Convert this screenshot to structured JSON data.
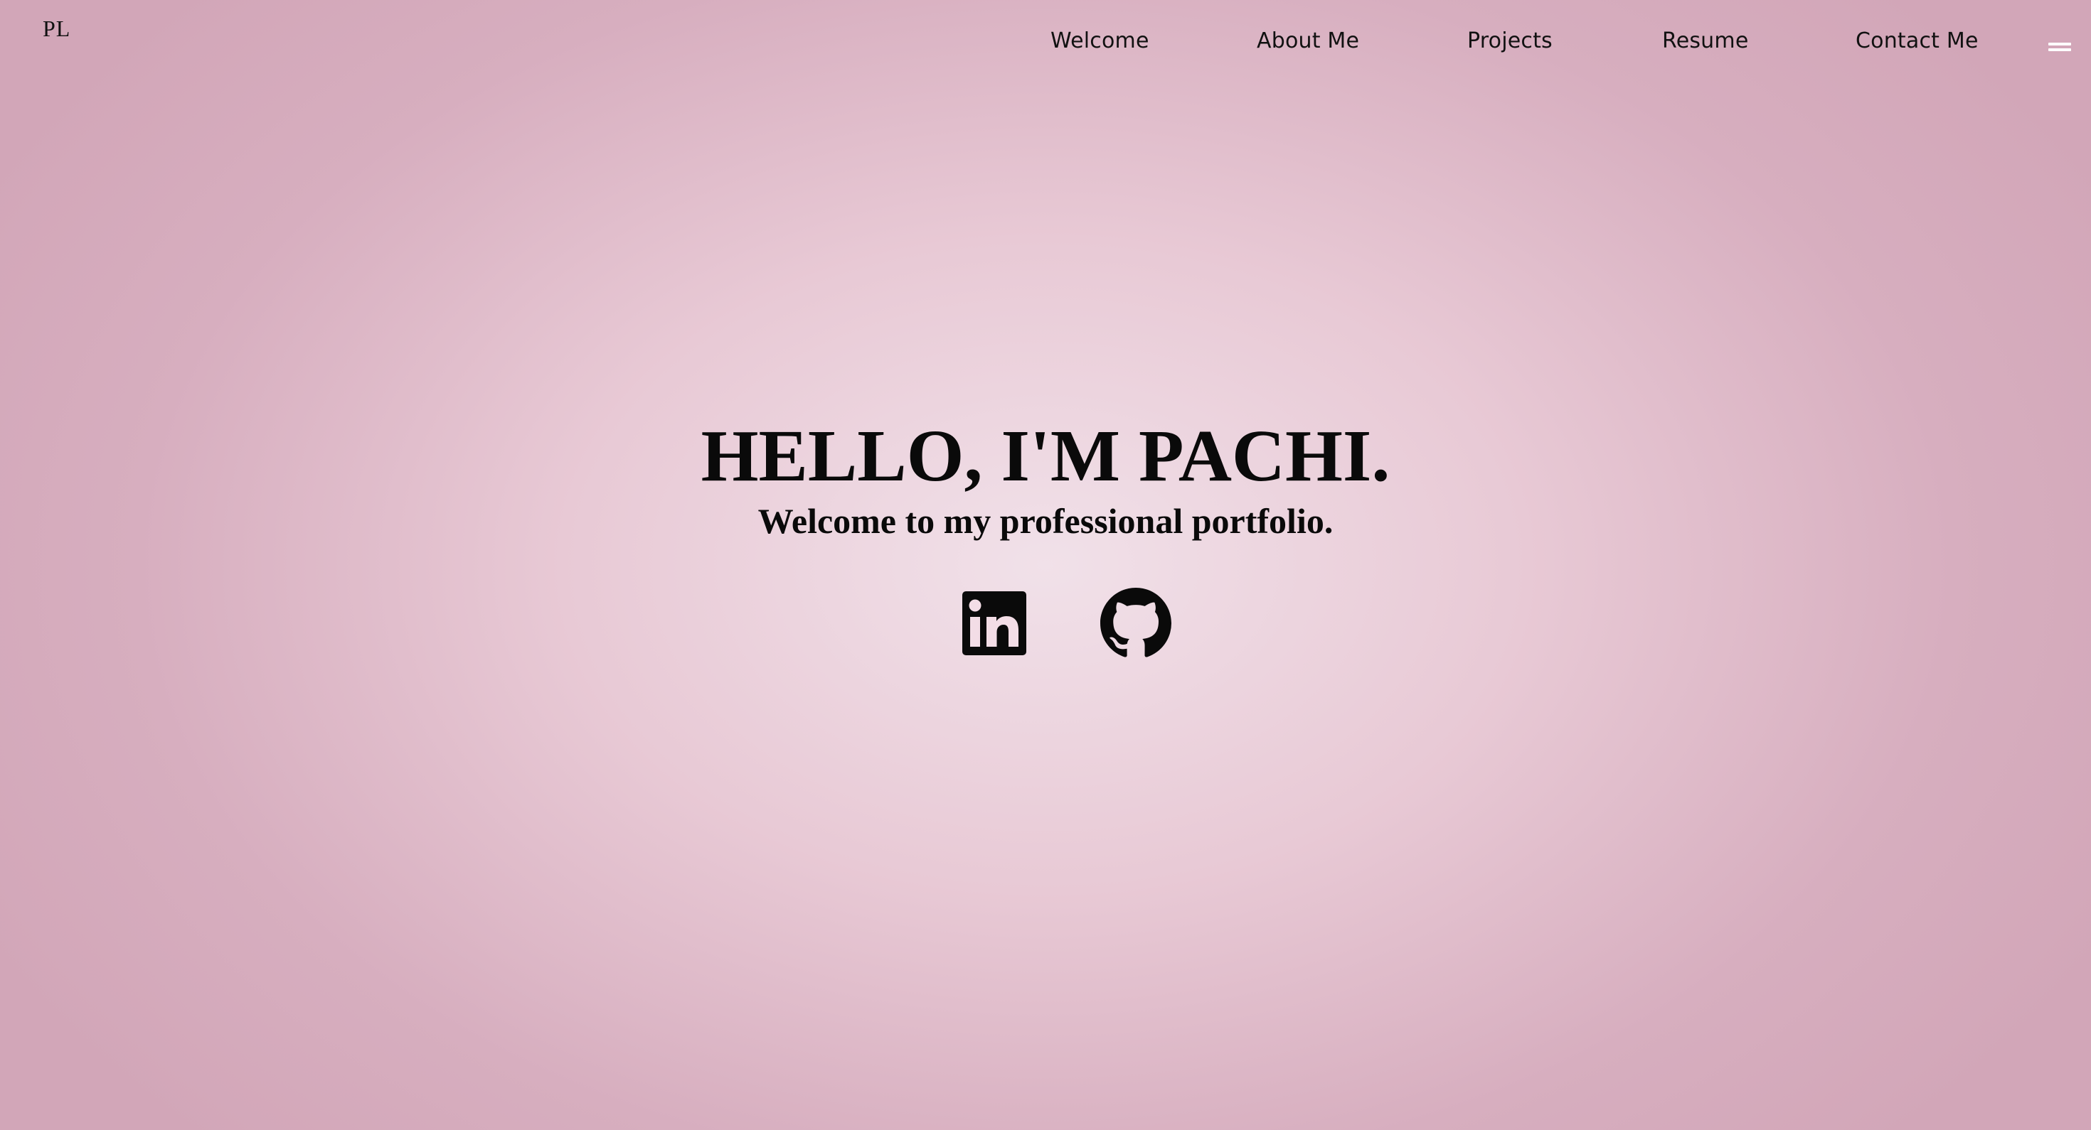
{
  "logo": {
    "text": "PL"
  },
  "nav": {
    "items": [
      {
        "label": "Welcome"
      },
      {
        "label": "About Me"
      },
      {
        "label": "Projects"
      },
      {
        "label": "Resume"
      },
      {
        "label": "Contact Me"
      }
    ]
  },
  "hero": {
    "title": "HELLO, I'M PACHI.",
    "subtitle": "Welcome to my professional portfolio."
  },
  "social": {
    "linkedin_icon": "linkedin-icon",
    "github_icon": "github-icon"
  },
  "colors": {
    "background_center": "#f1e1e9",
    "background_edge": "#d2a6b8",
    "text": "#0a0a0a",
    "menu_bars": "#ffffff"
  }
}
